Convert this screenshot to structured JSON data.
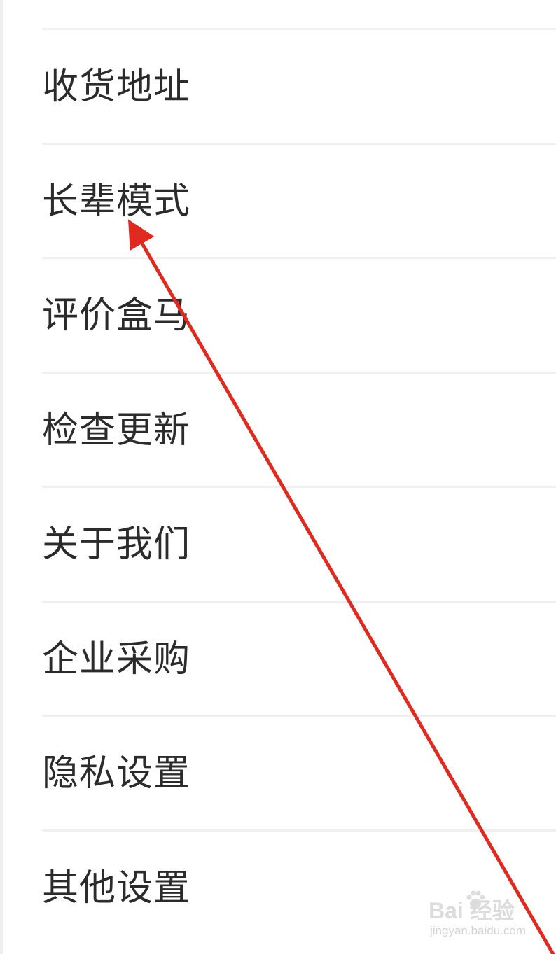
{
  "menu": {
    "items": [
      {
        "label": "收货地址"
      },
      {
        "label": "长辈模式"
      },
      {
        "label": "评价盒马"
      },
      {
        "label": "检查更新"
      },
      {
        "label": "关于我们"
      },
      {
        "label": "企业采购"
      },
      {
        "label": "隐私设置"
      },
      {
        "label": "其他设置"
      }
    ]
  },
  "annotation": {
    "color": "#e02a1f",
    "points_to": "长辈模式"
  },
  "watermark": {
    "logo_text": "Bai  经验",
    "url": "jingyan.baidu.com"
  },
  "colors": {
    "text": "#2b2b2b",
    "divider": "#f0f0f0",
    "background": "#ffffff"
  }
}
